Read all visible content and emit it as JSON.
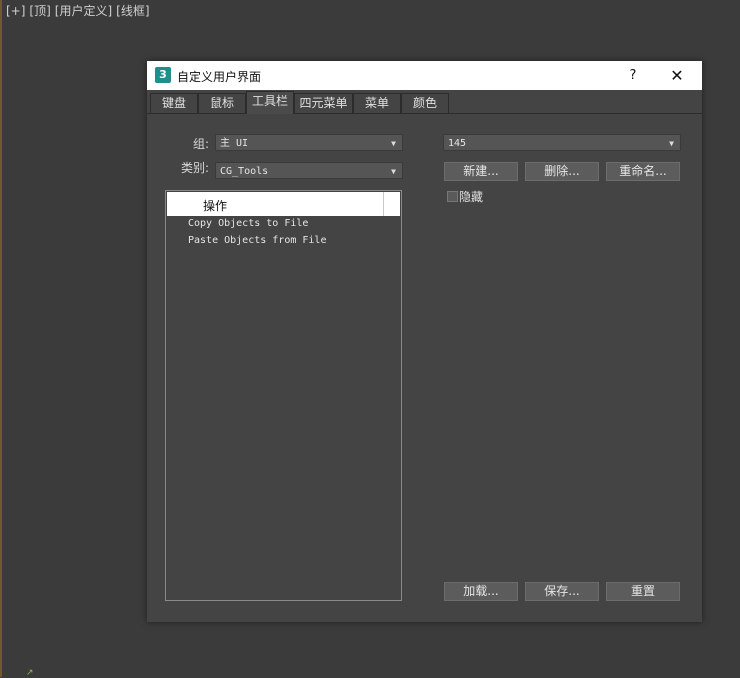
{
  "viewport": {
    "labels": [
      "[+]",
      "[顶]",
      "[用户定义]",
      "[线框]"
    ]
  },
  "dialog": {
    "title": "自定义用户界面",
    "app_icon_text": "3",
    "help_label": "?",
    "close_label": "✕",
    "tabs": [
      "键盘",
      "鼠标",
      "工具栏",
      "四元菜单",
      "菜单",
      "颜色"
    ],
    "active_tab": "工具栏",
    "group_label": "组:",
    "group_value": "主 UI",
    "category_label": "类别:",
    "category_value": "CG_Tools",
    "list_header": "操作",
    "list_items": [
      "Copy Objects to File",
      "Paste Objects from File"
    ],
    "toolbar_select_value": "145",
    "buttons": {
      "new": "新建...",
      "delete": "删除...",
      "rename": "重命名...",
      "load": "加载...",
      "save": "保存...",
      "reset": "重置"
    },
    "hide_label": "隐藏"
  }
}
